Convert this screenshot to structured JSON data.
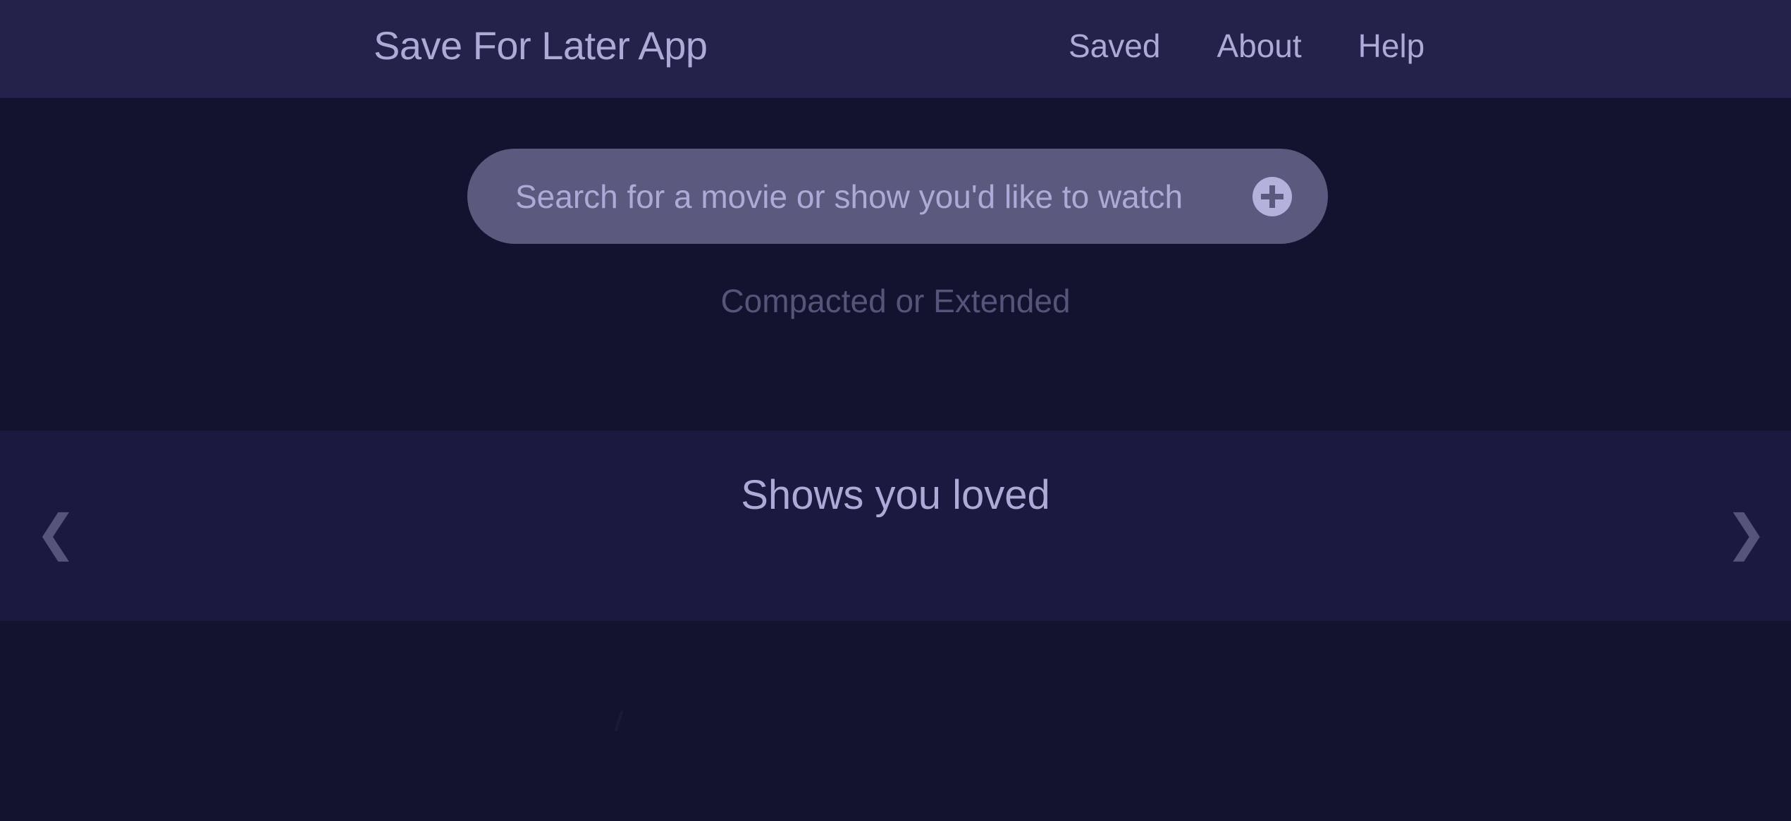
{
  "header": {
    "title": "Save For Later App",
    "nav": [
      {
        "label": "Saved"
      },
      {
        "label": "About"
      },
      {
        "label": "Help"
      }
    ]
  },
  "search": {
    "placeholder": "Search for a movie or show you'd like to watch",
    "value": "",
    "add_icon": "plus-circle-icon"
  },
  "view_toggle": {
    "label": "Compacted or Extended"
  },
  "carousel": {
    "title": "Shows you loved",
    "prev_icon": "chevron-left-icon",
    "next_icon": "chevron-right-icon"
  },
  "colors": {
    "background": "#13132f",
    "header": "#22224a",
    "search_bg": "#5b5a7e",
    "text": "#adaad8",
    "muted": "#55547a",
    "carousel_bg": "#1a1a40"
  }
}
